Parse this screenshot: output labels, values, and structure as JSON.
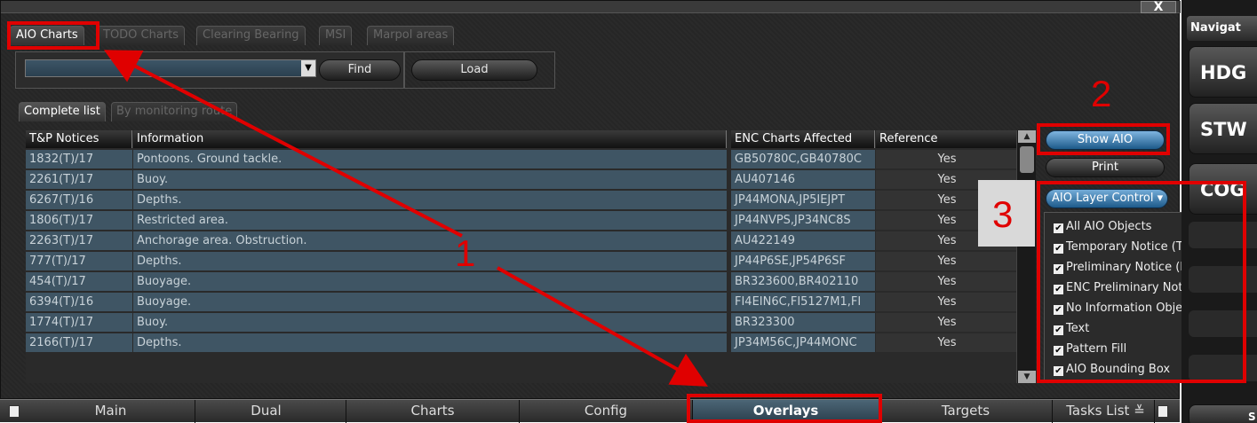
{
  "window": {
    "close_label": "X"
  },
  "top_tabs": [
    {
      "label": "AIO Charts",
      "active": true
    },
    {
      "label": "TODO Charts",
      "active": false
    },
    {
      "label": "Clearing Bearing",
      "active": false
    },
    {
      "label": "MSI",
      "active": false
    },
    {
      "label": "Marpol areas",
      "active": false
    }
  ],
  "search": {
    "selected_value": "",
    "arrow": "▼",
    "find_label": "Find",
    "load_label": "Load"
  },
  "sub_tabs": [
    {
      "label": "Complete list",
      "active": true
    },
    {
      "label": "By monitoring route",
      "active": false
    }
  ],
  "table": {
    "headers": [
      "T&P Notices",
      "Information",
      "ENC Charts Affected",
      "Reference"
    ],
    "rows": [
      [
        "1832(T)/17",
        "Pontoons. Ground tackle.",
        "GB50780C,GB40780C",
        "Yes"
      ],
      [
        "2261(T)/17",
        "Buoy.",
        "AU407146",
        "Yes"
      ],
      [
        "6267(T)/16",
        "Depths.",
        "JP44MONA,JP5IEJPT",
        "Yes"
      ],
      [
        "1806(T)/17",
        "Restricted area.",
        "JP44NVPS,JP34NC8S",
        "Yes"
      ],
      [
        "2263(T)/17",
        "Anchorage area. Obstruction.",
        "AU422149",
        "Yes"
      ],
      [
        "777(T)/17",
        "Depths.",
        "JP44P6SE,JP54P6SF",
        "Yes"
      ],
      [
        "454(T)/17",
        "Buoyage.",
        "BR323600,BR402110",
        "Yes"
      ],
      [
        "6394(T)/16",
        "Buoyage.",
        "FI4EIN6C,FI5127M1,FI",
        "Yes"
      ],
      [
        "1774(T)/17",
        "Buoy.",
        "BR323300",
        "Yes"
      ],
      [
        "2166(T)/17",
        "Depths.",
        "JP34M56C,JP44MONC",
        "Yes"
      ]
    ]
  },
  "right_panel": {
    "show_aio_label": "Show AIO",
    "print_label": "Print",
    "layer_control_label": "AIO Layer Control",
    "layer_control_arrow": "▾",
    "layers": [
      {
        "label": "All AIO Objects",
        "checked": true
      },
      {
        "label": "Temporary Notice (T)",
        "checked": true
      },
      {
        "label": "Preliminary Notice (P)",
        "checked": true
      },
      {
        "label": "ENC Preliminary Notice (EP)",
        "checked": true
      },
      {
        "label": "No Information Objects",
        "checked": true
      },
      {
        "label": "Text",
        "checked": true
      },
      {
        "label": "Pattern Fill",
        "checked": true
      },
      {
        "label": "AIO Bounding Box",
        "checked": true
      }
    ],
    "check_glyph": "✔"
  },
  "bottom_tabs": [
    {
      "label": "Main",
      "active": false
    },
    {
      "label": "Dual",
      "active": false
    },
    {
      "label": "Charts",
      "active": false
    },
    {
      "label": "Config",
      "active": false
    },
    {
      "label": "Overlays",
      "active": true
    },
    {
      "label": "Targets",
      "active": false
    },
    {
      "label": "Tasks List",
      "active": false
    }
  ],
  "tasks_list_arrow": "≚",
  "nav_panel": {
    "title": "Navigat",
    "buttons": [
      "HDG",
      "STW",
      "COG"
    ],
    "bottom_label": "S"
  },
  "annotations": {
    "label_1": "1",
    "label_2": "2",
    "label_3": "3",
    "color": "#e00000"
  }
}
